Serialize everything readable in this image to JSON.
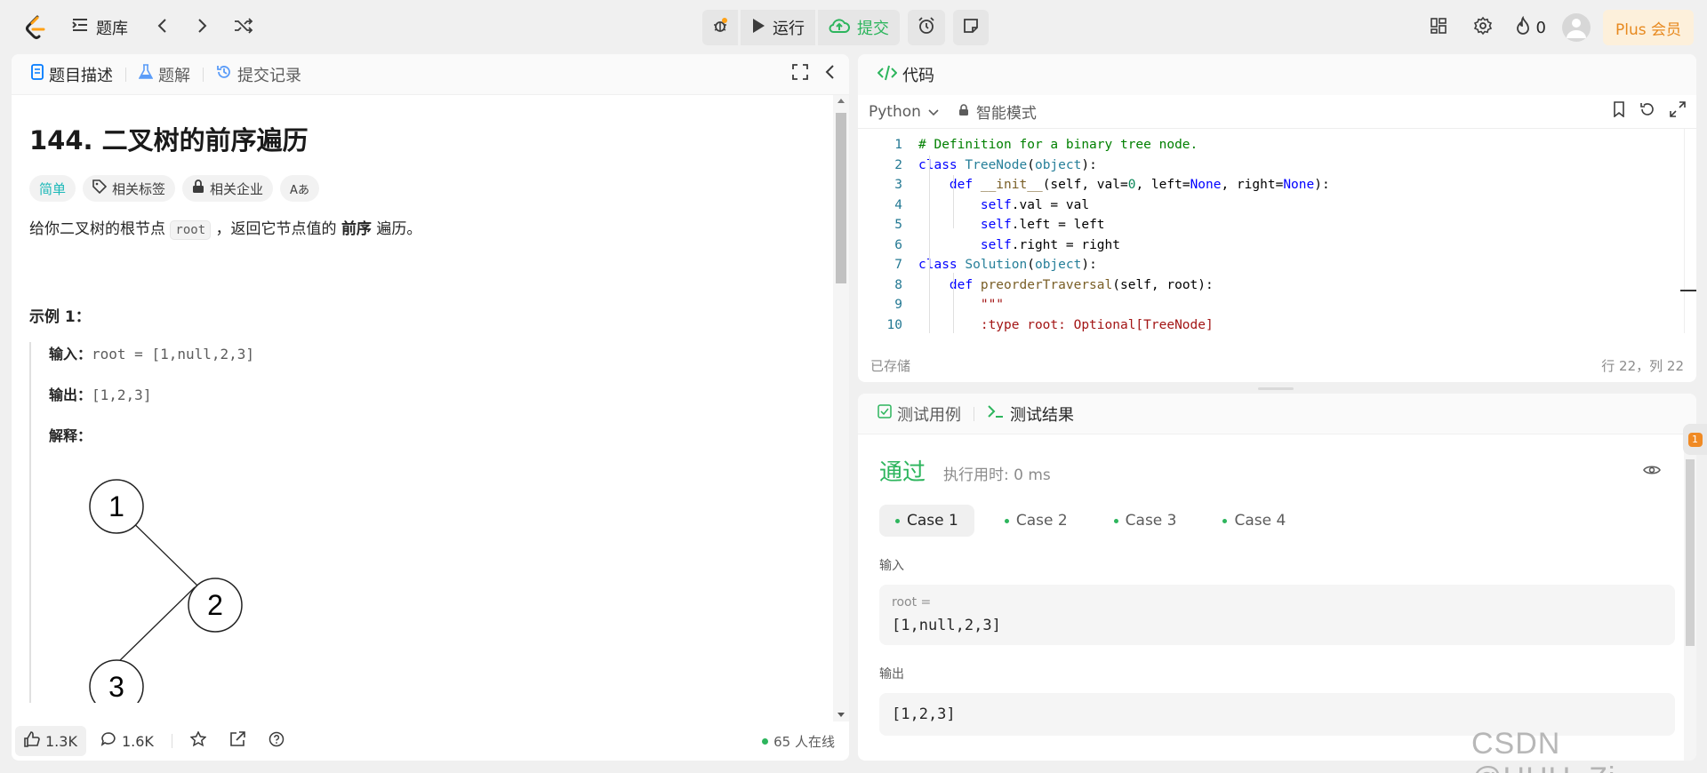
{
  "topbar": {
    "problem_list": "题库",
    "run": "运行",
    "submit": "提交",
    "fire_count": "0",
    "plus": "Plus 会员"
  },
  "left": {
    "tabs": [
      "题目描述",
      "题解",
      "提交记录"
    ],
    "title": "144. 二叉树的前序遍历",
    "tags": {
      "difficulty": "简单",
      "related_tags": "相关标签",
      "companies": "相关企业",
      "translate": "Aあ"
    },
    "desc_pre": "给你二叉树的根节点 ",
    "desc_code": "root",
    "desc_mid": " ，返回它节点值的 ",
    "desc_bold": "前序",
    "desc_post": " 遍历。",
    "example_title": "示例 1：",
    "input_label": "输入：",
    "input_value": "root = [1,null,2,3]",
    "output_label": "输出：",
    "output_value": "[1,2,3]",
    "explain_label": "解释：",
    "tree_nodes": [
      "1",
      "2",
      "3"
    ],
    "footer": {
      "likes": "1.3K",
      "comments": "1.6K",
      "online": "65 人在线"
    }
  },
  "code": {
    "tab": "代码",
    "language": "Python",
    "mode": "智能模式",
    "saved": "已存储",
    "position": "行 22，列 22",
    "lines": [
      {
        "n": "1"
      },
      {
        "n": "2"
      },
      {
        "n": "3"
      },
      {
        "n": "4"
      },
      {
        "n": "5"
      },
      {
        "n": "6"
      },
      {
        "n": "7"
      },
      {
        "n": "8"
      },
      {
        "n": "9"
      },
      {
        "n": "10"
      }
    ],
    "text": {
      "l1": "# Definition for a binary tree node.",
      "l2a": "class ",
      "l2b": "TreeNode",
      "l2c": "(",
      "l2d": "object",
      "l2e": "):",
      "l3a": "    def ",
      "l3b": "__init__",
      "l3c": "(self, val=",
      "l3d": "0",
      "l3e": ", left=",
      "l3f": "None",
      "l3g": ", right=",
      "l3h": "None",
      "l3i": "):",
      "l4a": "        self",
      "l4b": ".val = val",
      "l5a": "        self",
      "l5b": ".left = left",
      "l6a": "        self",
      "l6b": ".right = right",
      "l7a": "class ",
      "l7b": "Solution",
      "l7c": "(",
      "l7d": "object",
      "l7e": "):",
      "l8a": "    def ",
      "l8b": "preorderTraversal",
      "l8c": "(self, root):",
      "l9": "        \"\"\"",
      "l10": "        :type root: Optional[TreeNode]"
    }
  },
  "test": {
    "tabs": [
      "测试用例",
      "测试结果"
    ],
    "status": "通过",
    "runtime": "执行用时: 0 ms",
    "cases": [
      "Case 1",
      "Case 2",
      "Case 3",
      "Case 4"
    ],
    "input_label": "输入",
    "input_key": "root =",
    "input_value": "[1,null,2,3]",
    "output_label": "输出",
    "output_value": "[1,2,3]",
    "badge": "1"
  },
  "watermark": "CSDN @HHU_Zj"
}
